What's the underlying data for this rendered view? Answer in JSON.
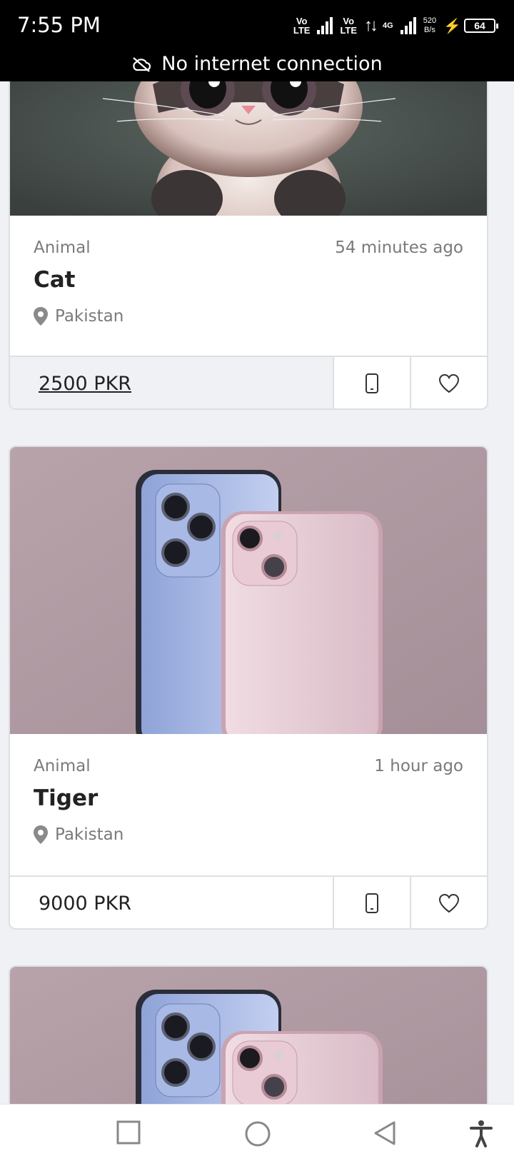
{
  "status_bar": {
    "time": "7:55 PM",
    "sim1": [
      "Vo",
      "LTE"
    ],
    "sim2": [
      "Vo",
      "LTE"
    ],
    "network": "4G",
    "speed_value": "520",
    "speed_unit": "B/s",
    "battery": "64"
  },
  "banner": {
    "text": "No internet connection",
    "icon": "cloud-off-icon"
  },
  "listings": [
    {
      "category": "Animal",
      "time": "54 minutes ago",
      "title": "Cat",
      "location": "Pakistan",
      "price": "2500 PKR",
      "image": "cartoon-cat-photo"
    },
    {
      "category": "Animal",
      "time": "1 hour ago",
      "title": "Tiger",
      "location": "Pakistan",
      "price": "9000 PKR",
      "image": "two-smartphones-photo"
    },
    {
      "image": "two-smartphones-photo"
    }
  ],
  "nav_bar": {
    "buttons": [
      "recents-icon",
      "home-icon",
      "back-icon",
      "accessibility-icon"
    ]
  },
  "colors": {
    "background": "#eff1f5",
    "card_border": "#dcdfe4",
    "muted_text": "#7a7a7a",
    "title_text": "#222222"
  }
}
